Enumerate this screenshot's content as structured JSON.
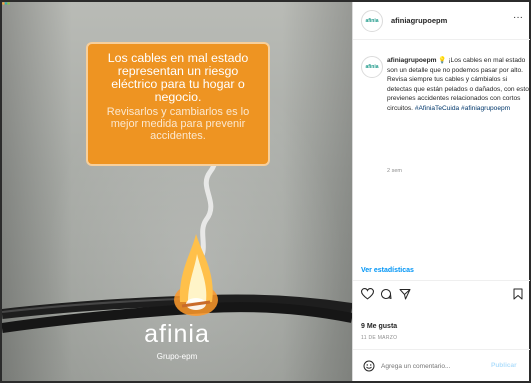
{
  "post_image": {
    "callout_bold": "Los cables en mal estado representan un riesgo eléctrico para tu hogar o negocio.",
    "callout_light": "Revisarlos y cambiarlos es lo mejor medida para prevenir accidentes.",
    "brand_name": "afinia",
    "brand_sub": "Grupo-epm",
    "colors": {
      "callout": "#ee9422",
      "wire": "#1e1e1e",
      "flame": "#ffb43a"
    }
  },
  "header": {
    "avatar_text": "afinia",
    "username": "afiniagrupoepm",
    "more_icon": "more-horizontal-icon"
  },
  "caption": {
    "avatar_text": "afinia",
    "username": "afiniagrupoepm",
    "body": "💡 ¡Los cables en mal estado son un detalle que no podemos pasar por alto. Revisa siempre tus cables y cámbialos si detectas que están pelados o dañados, con esto previenes accidentes relacionados con cortos circuitos. ",
    "hashtags": "#AfiniaTeCuida #afiniagrupoepm",
    "time_ago": "2 sem"
  },
  "stats_link": "Ver estadísticas",
  "actions": {
    "icons": [
      "heart-icon",
      "comment-icon",
      "share-icon",
      "bookmark-icon"
    ]
  },
  "likes": "9 Me gusta",
  "date": "11 DE MARZO",
  "comment_box": {
    "emoji_icon": "emoji-icon",
    "placeholder": "Agrega un comentario...",
    "publish_label": "Publicar",
    "publish_color": "#b2dffc"
  }
}
